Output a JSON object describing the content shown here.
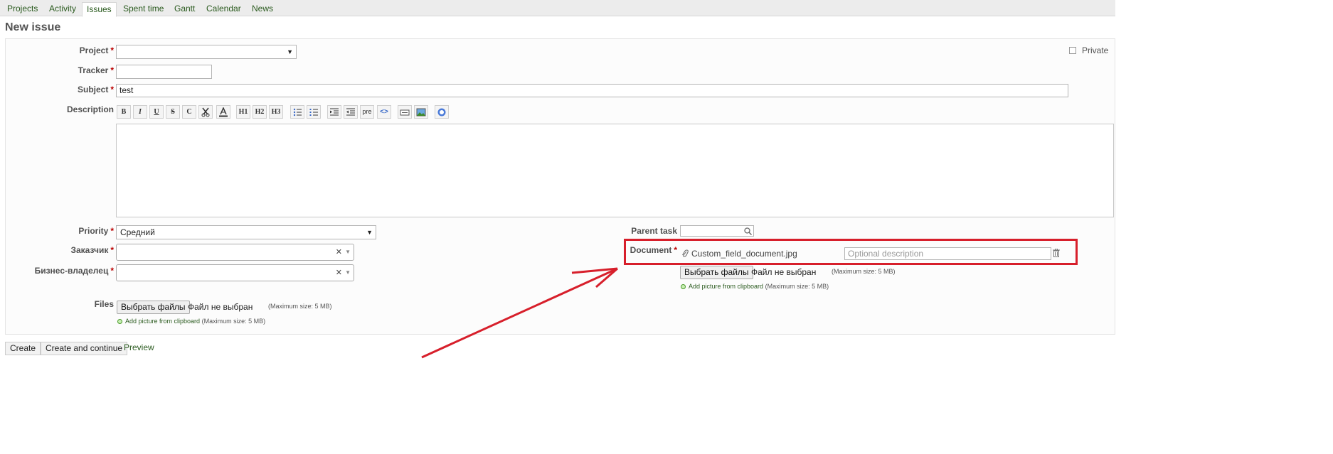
{
  "tabs": [
    {
      "label": "Projects"
    },
    {
      "label": "Activity"
    },
    {
      "label": "Issues",
      "selected": true
    },
    {
      "label": "Spent time"
    },
    {
      "label": "Gantt"
    },
    {
      "label": "Calendar"
    },
    {
      "label": "News"
    }
  ],
  "page_title": "New issue",
  "required_marker": "*",
  "fields": {
    "project": {
      "label": "Project"
    },
    "tracker": {
      "label": "Tracker"
    },
    "subject": {
      "label": "Subject",
      "value": "test"
    },
    "description": {
      "label": "Description",
      "value": ""
    },
    "private": {
      "label": "Private",
      "checked": false
    },
    "priority": {
      "label": "Priority",
      "value": "Средний"
    },
    "customer": {
      "label": "Заказчик"
    },
    "business_owner": {
      "label": "Бизнес-владелец"
    },
    "files": {
      "label": "Files",
      "choose_button": "Выбрать файлы",
      "no_file": "Файл не выбран",
      "max_size": "(Maximum size: 5 MB)",
      "clipboard_link": "Add picture from clipboard",
      "clipboard_max": "(Maximum size: 5 MB)"
    },
    "parent_task": {
      "label": "Parent task"
    },
    "document": {
      "label": "Document",
      "filename": "Custom_field_document.jpg",
      "description_placeholder": "Optional description",
      "choose_button": "Выбрать файлы",
      "no_file": "Файл не выбран",
      "max_size": "(Maximum size: 5 MB)",
      "clipboard_link": "Add picture from clipboard",
      "clipboard_max": "(Maximum size: 5 MB)"
    }
  },
  "toolbar": {
    "bold": "B",
    "italic": "I",
    "underline": "U",
    "strike": "S",
    "code": "C",
    "h1": "H1",
    "h2": "H2",
    "h3": "H3",
    "pre": "pre"
  },
  "buttons": {
    "create": "Create",
    "create_continue": "Create and continue",
    "preview": "Preview"
  },
  "colors": {
    "link_green": "#2a5a1e",
    "required_red": "#bb0000",
    "annotation_red": "#d71f2b"
  }
}
